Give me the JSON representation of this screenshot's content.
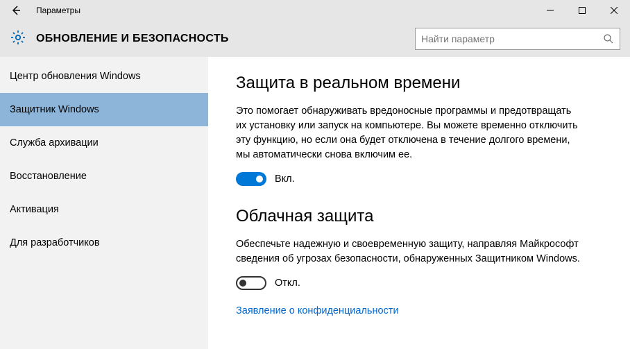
{
  "titlebar": {
    "title": "Параметры"
  },
  "header": {
    "title": "ОБНОВЛЕНИЕ И БЕЗОПАСНОСТЬ"
  },
  "search": {
    "placeholder": "Найти параметр"
  },
  "sidebar": {
    "items": [
      {
        "label": "Центр обновления Windows"
      },
      {
        "label": "Защитник Windows"
      },
      {
        "label": "Служба архивации"
      },
      {
        "label": "Восстановление"
      },
      {
        "label": "Активация"
      },
      {
        "label": "Для разработчиков"
      }
    ],
    "selected_index": 1
  },
  "content": {
    "section1": {
      "title": "Защита в реальном времени",
      "desc": "Это помогает обнаруживать вредоносные программы и предотвращать их установку или запуск на компьютере. Вы можете временно отключить эту функцию, но если она будет отключена в течение долгого времени, мы автоматически снова включим ее.",
      "toggle_state": "on",
      "toggle_label": "Вкл."
    },
    "section2": {
      "title": "Облачная защита",
      "desc": "Обеспечьте надежную и своевременную защиту, направляя Майкрософт сведения об угрозах безопасности, обнаруженных Защитником Windows.",
      "toggle_state": "off",
      "toggle_label": "Откл."
    },
    "privacy_link": "Заявление о конфиденциальности"
  }
}
